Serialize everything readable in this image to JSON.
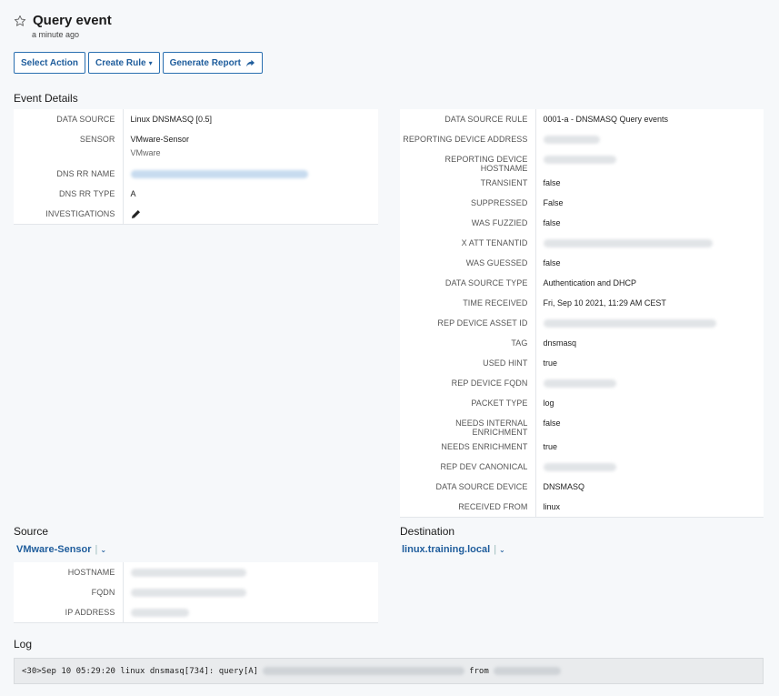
{
  "header": {
    "title": "Query event",
    "subtitle": "a minute ago"
  },
  "actions": {
    "select_action": "Select Action",
    "create_rule": "Create Rule",
    "generate_report": "Generate Report"
  },
  "event_details": {
    "title": "Event Details",
    "data_source_label": "DATA SOURCE",
    "data_source_value": "Linux DNSMASQ [0.5]",
    "sensor_label": "SENSOR",
    "sensor_value": "VMware-Sensor",
    "sensor_sub": "VMware",
    "dns_rr_name_label": "DNS RR NAME",
    "dns_rr_type_label": "DNS RR TYPE",
    "dns_rr_type_value": "A",
    "investigations_label": "INVESTIGATIONS"
  },
  "right_details": {
    "data_source_rule_label": "DATA SOURCE RULE",
    "data_source_rule_value": "0001-a - DNSMASQ Query events",
    "reporting_device_address_label": "REPORTING DEVICE ADDRESS",
    "reporting_device_hostname_label": "REPORTING DEVICE HOSTNAME",
    "transient_label": "TRANSIENT",
    "transient_value": "false",
    "suppressed_label": "SUPPRESSED",
    "suppressed_value": "False",
    "was_fuzzied_label": "WAS FUZZIED",
    "was_fuzzied_value": "false",
    "x_att_tenantid_label": "X ATT TENANTID",
    "was_guessed_label": "WAS GUESSED",
    "was_guessed_value": "false",
    "data_source_type_label": "DATA SOURCE TYPE",
    "data_source_type_value": "Authentication and DHCP",
    "time_received_label": "TIME RECEIVED",
    "time_received_value": "Fri, Sep 10 2021, 11:29 AM CEST",
    "rep_device_asset_id_label": "REP DEVICE ASSET ID",
    "tag_label": "TAG",
    "tag_value": "dnsmasq",
    "used_hint_label": "USED HINT",
    "used_hint_value": "true",
    "rep_device_fqdn_label": "REP DEVICE FQDN",
    "packet_type_label": "PACKET TYPE",
    "packet_type_value": "log",
    "needs_internal_enrichment_label": "NEEDS INTERNAL ENRICHMENT",
    "needs_internal_enrichment_value": "false",
    "needs_enrichment_label": "NEEDS ENRICHMENT",
    "needs_enrichment_value": "true",
    "rep_dev_canonical_label": "REP DEV CANONICAL",
    "data_source_device_label": "DATA SOURCE DEVICE",
    "data_source_device_value": "DNSMASQ",
    "received_from_label": "RECEIVED FROM",
    "received_from_value": "linux"
  },
  "source": {
    "title": "Source",
    "entity": "VMware-Sensor",
    "hostname_label": "HOSTNAME",
    "fqdn_label": "FQDN",
    "ip_address_label": "IP ADDRESS"
  },
  "destination": {
    "title": "Destination",
    "entity": "linux.training.local"
  },
  "log": {
    "title": "Log",
    "prefix": "<30>Sep 10 05:29:20 linux dnsmasq[734]: query[A]",
    "from_word": "from"
  },
  "icons": {
    "star": "star-outline-icon",
    "pencil": "pencil-icon",
    "share": "share-arrow-icon",
    "chevron": "chevron-down-icon"
  }
}
